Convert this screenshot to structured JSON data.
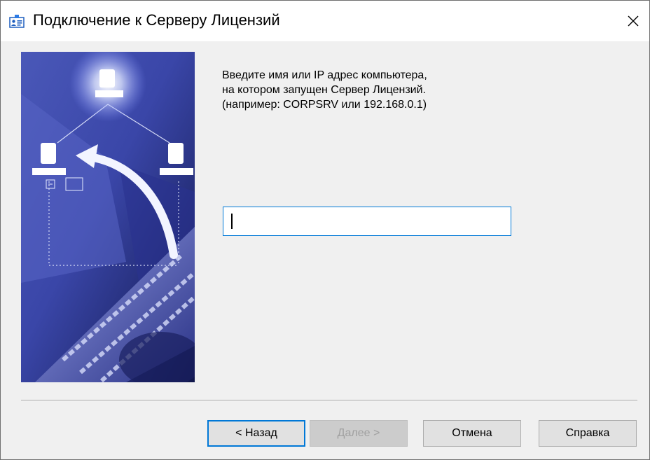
{
  "window": {
    "title": "Подключение к Серверу Лицензий",
    "icon": "license-server-icon",
    "close_icon": "close-icon"
  },
  "wizard": {
    "image": "computer-network-keyboard-illustration",
    "instruction_lines": [
      "Введите имя или IP адрес компьютера,",
      "на котором запущен Сервер Лицензий.",
      "(например: CORPSRV или 192.168.0.1)"
    ],
    "server_input": {
      "value": "",
      "placeholder": ""
    }
  },
  "buttons": {
    "back": "< Назад",
    "next": "Далее >",
    "cancel": "Отмена",
    "help": "Справка"
  },
  "colors": {
    "accent": "#0078d7",
    "dialog_bg": "#f0f0f0",
    "disabled_text": "#a0a0a0"
  }
}
